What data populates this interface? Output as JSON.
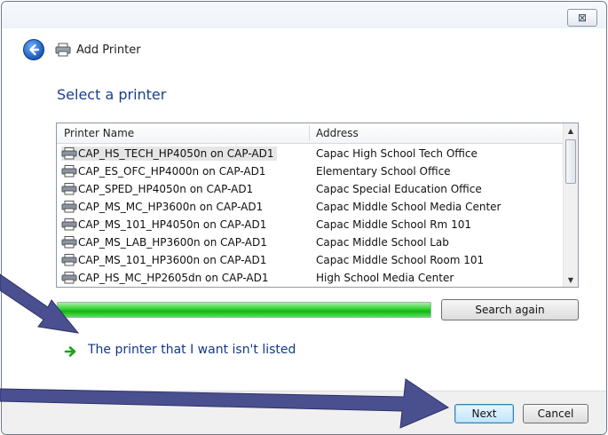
{
  "window": {
    "title": "Add Printer",
    "close_glyph": "⊠",
    "back_icon": "back-arrow-icon",
    "title_icon": "printer-icon"
  },
  "heading": "Select a printer",
  "list": {
    "columns": [
      "Printer Name",
      "Address"
    ],
    "rows": [
      {
        "name": "CAP_HS_TECH_HP4050n on CAP-AD1",
        "address": "Capac High School Tech Office",
        "selected": true
      },
      {
        "name": "CAP_ES_OFC_HP4000n on CAP-AD1",
        "address": "Elementary School Office"
      },
      {
        "name": "CAP_SPED_HP4050n on CAP-AD1",
        "address": "Capac Special Education Office"
      },
      {
        "name": "CAP_MS_MC_HP3600n on CAP-AD1",
        "address": "Capac Middle School Media Center"
      },
      {
        "name": "CAP_MS_101_HP4050n on CAP-AD1",
        "address": "Capac Middle School Rm 101"
      },
      {
        "name": "CAP_MS_LAB_HP3600n on CAP-AD1",
        "address": "Capac Middle School Lab"
      },
      {
        "name": "CAP_MS_101_HP3600n on CAP-AD1",
        "address": "Capac Middle School Room 101"
      },
      {
        "name": "CAP_HS_MC_HP2605dn on CAP-AD1",
        "address": "High School Media Center"
      }
    ]
  },
  "progress": {
    "value": 1.0
  },
  "buttons": {
    "search_again": "Search again",
    "next": "Next",
    "cancel": "Cancel"
  },
  "link": {
    "label": "The printer that I want isn't listed",
    "icon": "green-arrow-icon"
  },
  "colors": {
    "accent_blue": "#1a3e8f",
    "link_blue": "#13388a",
    "progress_green": "#16b216",
    "annotation_arrow": "#4a4f8f"
  }
}
